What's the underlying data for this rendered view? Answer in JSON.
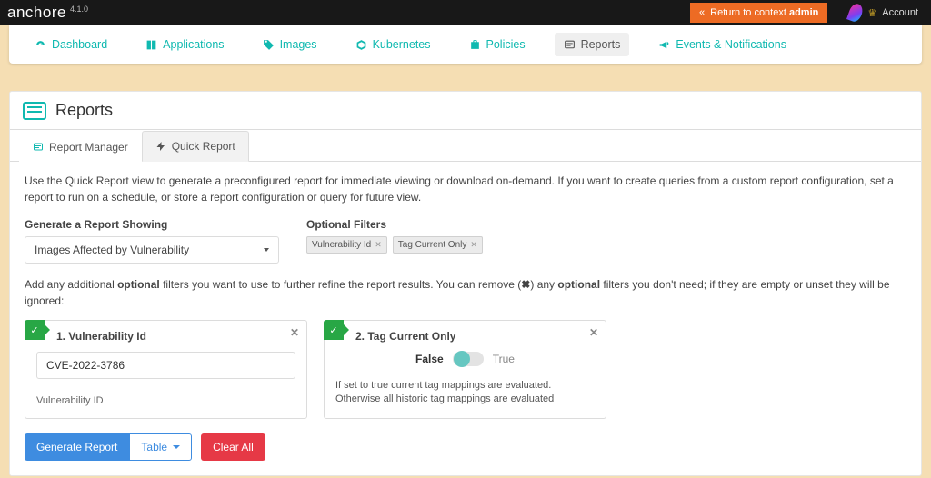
{
  "topbar": {
    "brand": "anchore",
    "version": "4.1.0",
    "return_prefix": "Return to context ",
    "return_target": "admin",
    "account_label": "Account"
  },
  "nav": {
    "items": [
      {
        "label": "Dashboard"
      },
      {
        "label": "Applications"
      },
      {
        "label": "Images"
      },
      {
        "label": "Kubernetes"
      },
      {
        "label": "Policies"
      },
      {
        "label": "Reports"
      },
      {
        "label": "Events & Notifications"
      }
    ],
    "active_index": 5
  },
  "page": {
    "title": "Reports"
  },
  "tabs": {
    "items": [
      {
        "label": "Report Manager"
      },
      {
        "label": "Quick Report"
      }
    ],
    "active_index": 1
  },
  "quick": {
    "description": "Use the Quick Report view to generate a preconfigured report for immediate viewing or download on-demand. If you want to create queries from a custom report configuration, set a report to run on a schedule, or store a report configuration or query for future view.",
    "generate_label": "Generate a Report Showing",
    "generate_value": "Images Affected by Vulnerability",
    "optional_label": "Optional Filters",
    "chips": [
      "Vulnerability Id",
      "Tag Current Only"
    ],
    "filter_hint_a": "Add any additional ",
    "filter_hint_b": "optional",
    "filter_hint_c": " filters you want to use to further refine the report results. You can remove (",
    "filter_hint_x": "✖",
    "filter_hint_d": ") any ",
    "filter_hint_e": "optional",
    "filter_hint_f": " filters you don't need; if they are empty or unset they will be ignored:"
  },
  "filters": [
    {
      "title": "1. Vulnerability Id",
      "input_value": "CVE-2022-3786",
      "caption": "Vulnerability ID"
    },
    {
      "title": "2. Tag Current Only",
      "toggle_false": "False",
      "toggle_true": "True",
      "toggle_on": false,
      "desc": "If set to true current tag mappings are evaluated. Otherwise all historic tag mappings are evaluated"
    }
  ],
  "buttons": {
    "generate": "Generate Report",
    "mode": "Table",
    "clear": "Clear All"
  }
}
